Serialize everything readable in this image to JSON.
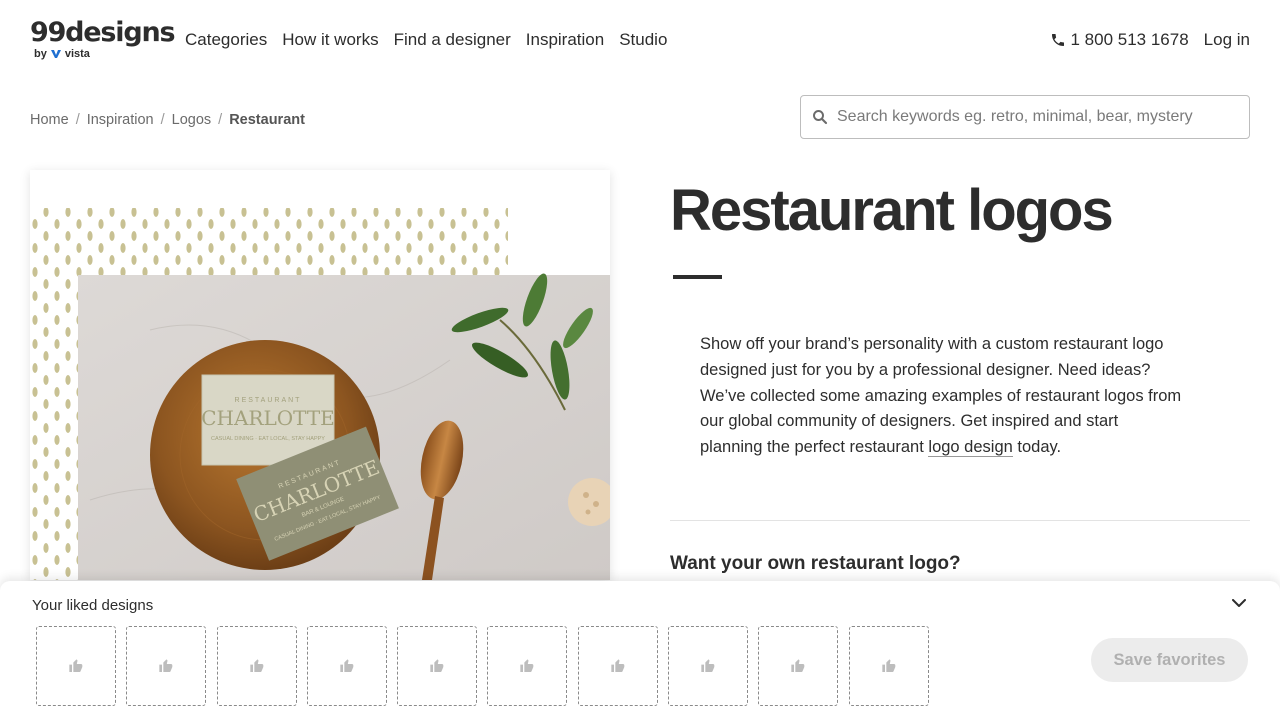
{
  "brand": {
    "wordmark": "99designs",
    "sub": "by",
    "sub_brand": "vista"
  },
  "nav": [
    "Categories",
    "How it works",
    "Find a designer",
    "Inspiration",
    "Studio"
  ],
  "header": {
    "phone": "1 800 513 1678",
    "login": "Log in"
  },
  "breadcrumb": [
    "Home",
    "Inspiration",
    "Logos",
    "Restaurant"
  ],
  "search": {
    "placeholder": "Search keywords eg. retro, minimal, bear, mystery",
    "value": ""
  },
  "hero": {
    "alt": "Restaurant Charlotte business card mockup",
    "card_top": "RESTAURANT",
    "card_name": "CHARLOTTE",
    "card_sub": "BAR & LOUNGE",
    "card_tagline": "CASUAL DINING · EAT LOCAL, STAY HAPPY"
  },
  "page": {
    "title": "Restaurant logos",
    "desc_text": "Show off your brand’s personality with a custom restaurant logo designed just for you by a professional designer. Need ideas? We’ve collected some amazing examples of restaurant logos from our global community of designers. Get inspired and start planning the perfect restaurant ",
    "desc_link": "logo design",
    "desc_end": " today.",
    "cta_heading": "Want your own restaurant logo?"
  },
  "liked": {
    "title": "Your liked designs",
    "slot_count": 10,
    "save_label": "Save favorites"
  },
  "colors": {
    "text": "#2d2d2d",
    "muted": "#6b6b6b",
    "disabled_bg": "#ececec",
    "disabled_text": "#b0b0b0"
  }
}
